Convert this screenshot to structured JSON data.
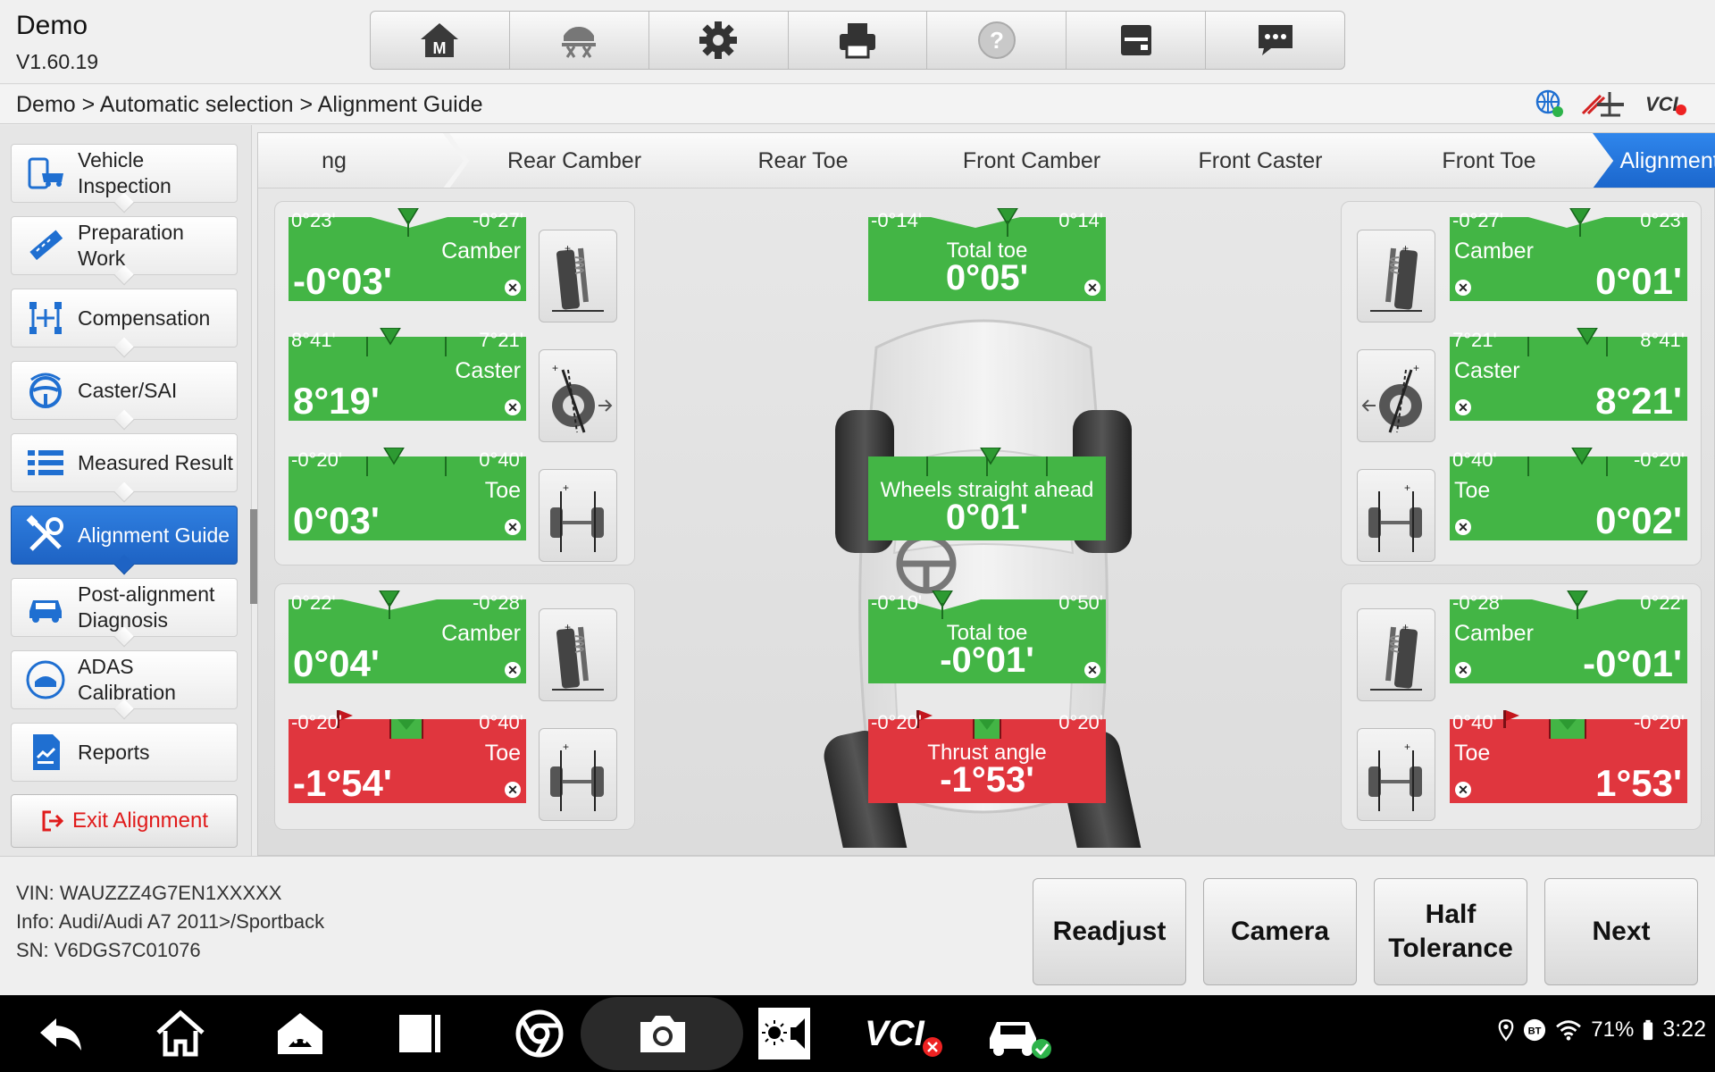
{
  "app": {
    "title": "Demo",
    "version": "V1.60.19"
  },
  "toolbar": {
    "buttons": [
      "home-m-icon",
      "lift-icon",
      "settings-gear-icon",
      "printer-icon",
      "help-icon",
      "save-icon",
      "feedback-chat-icon"
    ]
  },
  "breadcrumb": "Demo > Automatic selection > Alignment Guide",
  "status_icons": [
    "network-ok-icon",
    "lift-status-icon",
    "vci-disconnected-icon"
  ],
  "sidebar": {
    "items": [
      {
        "label": "Vehicle Inspection",
        "icon": "vehicle-inspection-icon"
      },
      {
        "label": "Preparation Work",
        "icon": "ruler-icon"
      },
      {
        "label": "Compensation",
        "icon": "compensation-icon"
      },
      {
        "label": "Caster/SAI",
        "icon": "steering-wheel-icon"
      },
      {
        "label": "Measured Result",
        "icon": "list-icon"
      },
      {
        "label": "Alignment Guide",
        "icon": "tools-icon"
      },
      {
        "label": "Post-alignment Diagnosis",
        "icon": "car-icon"
      },
      {
        "label": "ADAS Calibration",
        "icon": "adas-icon"
      },
      {
        "label": "Reports",
        "icon": "report-icon"
      }
    ],
    "active_index": 5,
    "exit_label": "Exit Alignment",
    "collapse_glyph": "❬"
  },
  "steps": [
    "ng",
    "Rear Camber",
    "Rear Toe",
    "Front Camber",
    "Front Caster",
    "Front Toe",
    "Alignment Result"
  ],
  "active_step": 6,
  "cards": {
    "front_left_camber": {
      "min": "0°23'",
      "max": "-0°27'",
      "name": "Camber",
      "value": "-0°03'",
      "status": "green"
    },
    "front_left_caster": {
      "min": "8°41'",
      "max": "7°21'",
      "name": "Caster",
      "value": "8°19'",
      "status": "green"
    },
    "front_left_toe": {
      "min": "-0°20'",
      "max": "0°40'",
      "name": "Toe",
      "value": "0°03'",
      "status": "green"
    },
    "rear_left_camber": {
      "min": "0°22'",
      "max": "-0°28'",
      "name": "Camber",
      "value": "0°04'",
      "status": "green"
    },
    "rear_left_toe": {
      "min": "-0°20'",
      "max": "0°40'",
      "name": "Toe",
      "value": "-1°54'",
      "status": "red"
    },
    "front_total_toe": {
      "min": "-0°14'",
      "max": "0°14'",
      "name": "Total toe",
      "value": "0°05'",
      "status": "green"
    },
    "wheels_straight": {
      "min": "",
      "max": "",
      "name": "Wheels straight ahead",
      "value": "0°01'",
      "status": "green"
    },
    "rear_total_toe": {
      "min": "-0°10'",
      "max": "0°50'",
      "name": "Total toe",
      "value": "-0°01'",
      "status": "green"
    },
    "thrust_angle": {
      "min": "-0°20'",
      "max": "0°20'",
      "name": "Thrust angle",
      "value": "-1°53'",
      "status": "red"
    },
    "front_right_camber": {
      "min": "-0°27'",
      "max": "0°23'",
      "name": "Camber",
      "value": "0°01'",
      "status": "green"
    },
    "front_right_caster": {
      "min": "7°21'",
      "max": "8°41'",
      "name": "Caster",
      "value": "8°21'",
      "status": "green"
    },
    "front_right_toe": {
      "min": "0°40'",
      "max": "-0°20'",
      "name": "Toe",
      "value": "0°02'",
      "status": "green"
    },
    "rear_right_camber": {
      "min": "-0°28'",
      "max": "0°22'",
      "name": "Camber",
      "value": "-0°01'",
      "status": "green"
    },
    "rear_right_toe": {
      "min": "0°40'",
      "max": "-0°20'",
      "name": "Toe",
      "value": "1°53'",
      "status": "red"
    }
  },
  "info": {
    "vin": "VIN: WAUZZZ4G7EN1XXXXX",
    "info": "Info: Audi/Audi A7 2011>/Sportback",
    "sn": "SN: V6DGS7C01076"
  },
  "actions": {
    "readjust": "Readjust",
    "camera": "Camera",
    "half_tolerance": "Half Tolerance",
    "next": "Next"
  },
  "system": {
    "battery": "71%",
    "time": "3:22"
  },
  "colors": {
    "green": "#43b545",
    "red": "#e0363e",
    "accent": "#1e63c4",
    "exit_red": "#e01b1b"
  }
}
